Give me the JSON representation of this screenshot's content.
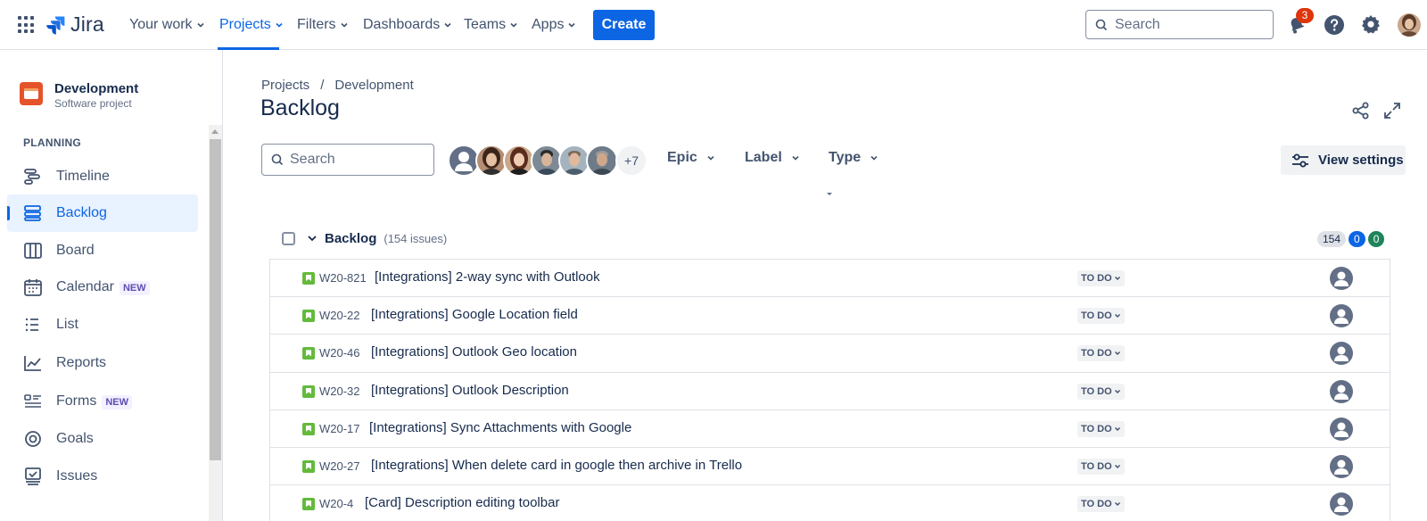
{
  "topnav": {
    "logo_text": "Jira",
    "items": [
      {
        "label": "Your work"
      },
      {
        "label": "Projects"
      },
      {
        "label": "Filters"
      },
      {
        "label": "Dashboards"
      },
      {
        "label": "Teams"
      },
      {
        "label": "Apps"
      }
    ],
    "create_label": "Create",
    "search_placeholder": "Search",
    "notification_count": "3"
  },
  "sidebar": {
    "project_name": "Development",
    "project_type": "Software project",
    "section_label": "PLANNING",
    "items": [
      {
        "label": "Timeline",
        "icon": "timeline-icon"
      },
      {
        "label": "Backlog",
        "icon": "backlog-icon"
      },
      {
        "label": "Board",
        "icon": "board-icon"
      },
      {
        "label": "Calendar",
        "icon": "calendar-icon",
        "badge": "NEW"
      },
      {
        "label": "List",
        "icon": "list-icon"
      },
      {
        "label": "Reports",
        "icon": "reports-icon"
      },
      {
        "label": "Forms",
        "icon": "forms-icon",
        "badge": "NEW"
      },
      {
        "label": "Goals",
        "icon": "goals-icon"
      },
      {
        "label": "Issues",
        "icon": "issues-icon"
      }
    ]
  },
  "main": {
    "breadcrumb": [
      "Projects",
      "/",
      "Development"
    ],
    "title": "Backlog",
    "search_placeholder": "Search",
    "more_avatars": "+7",
    "filters": [
      {
        "label": "Epic"
      },
      {
        "label": "Label"
      },
      {
        "label": "Type"
      }
    ],
    "view_settings_label": "View settings",
    "backlog": {
      "title": "Backlog",
      "count_text": "(154 issues)",
      "counts": [
        "154",
        "0",
        "0"
      ]
    },
    "issues": [
      {
        "key": "W20-821",
        "summary": "[Integrations] 2-way sync with Outlook",
        "status": "TO DO"
      },
      {
        "key": "W20-22",
        "summary": "[Integrations] Google Location field",
        "status": "TO DO"
      },
      {
        "key": "W20-46",
        "summary": "[Integrations] Outlook Geo location",
        "status": "TO DO"
      },
      {
        "key": "W20-32",
        "summary": "[Integrations] Outlook Description",
        "status": "TO DO"
      },
      {
        "key": "W20-17",
        "summary": "[Integrations] Sync Attachments with Google",
        "status": "TO DO"
      },
      {
        "key": "W20-27",
        "summary": "[Integrations] When delete card in google then archive in Trello",
        "status": "TO DO"
      },
      {
        "key": "W20-4",
        "summary": "[Card] Description editing toolbar",
        "status": "TO DO"
      }
    ]
  },
  "colors": {
    "accent": "#0c66e4",
    "story": "#63ba3c",
    "project": "#e5532b"
  }
}
